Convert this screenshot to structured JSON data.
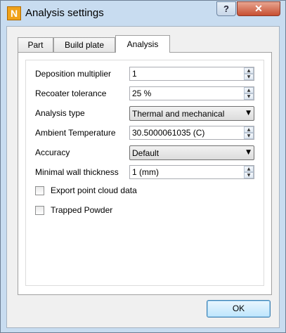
{
  "window": {
    "title": "Analysis settings",
    "app_icon_letter": "N",
    "help_label": "?",
    "close_label": "✕"
  },
  "tabs": [
    {
      "label": "Part"
    },
    {
      "label": "Build plate"
    },
    {
      "label": "Analysis"
    }
  ],
  "active_tab": "Analysis",
  "fields": {
    "deposition_multiplier": {
      "label": "Deposition multiplier",
      "value": "1"
    },
    "recoater_tolerance": {
      "label": "Recoater tolerance",
      "value": "25 %"
    },
    "analysis_type": {
      "label": "Analysis type",
      "value": "Thermal and mechanical"
    },
    "ambient_temperature": {
      "label": "Ambient Temperature",
      "value": "30.5000061035 (C)"
    },
    "accuracy": {
      "label": "Accuracy",
      "value": "Default"
    },
    "minimal_wall_thickness": {
      "label": "Minimal wall thickness",
      "value": "1 (mm)"
    }
  },
  "checkboxes": {
    "export_point_cloud": {
      "label": "Export point cloud data",
      "checked": false
    },
    "trapped_powder": {
      "label": "Trapped Powder",
      "checked": false
    }
  },
  "buttons": {
    "ok_label": "OK"
  },
  "icons": {
    "spin_up": "▲",
    "spin_down": "▼",
    "dropdown": "▼"
  }
}
